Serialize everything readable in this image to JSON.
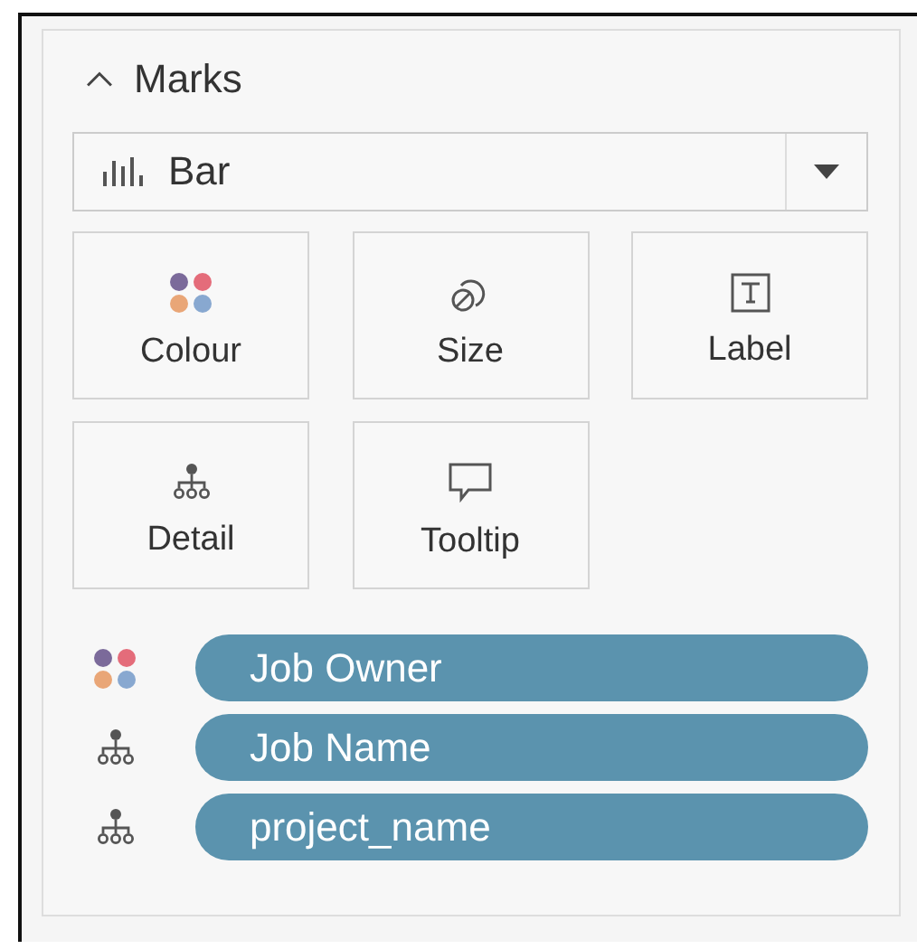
{
  "marks": {
    "title": "Marks",
    "expanded": true,
    "mark_type": {
      "kind": "bar",
      "label": "Bar"
    },
    "cards": [
      {
        "kind": "color",
        "label": "Colour"
      },
      {
        "kind": "size",
        "label": "Size"
      },
      {
        "kind": "label",
        "label": "Label"
      },
      {
        "kind": "detail",
        "label": "Detail"
      },
      {
        "kind": "tooltip",
        "label": "Tooltip"
      }
    ],
    "fields": [
      {
        "kind": "color",
        "label": "Job Owner"
      },
      {
        "kind": "detail",
        "label": "Job Name"
      },
      {
        "kind": "detail",
        "label": "project_name"
      }
    ]
  }
}
